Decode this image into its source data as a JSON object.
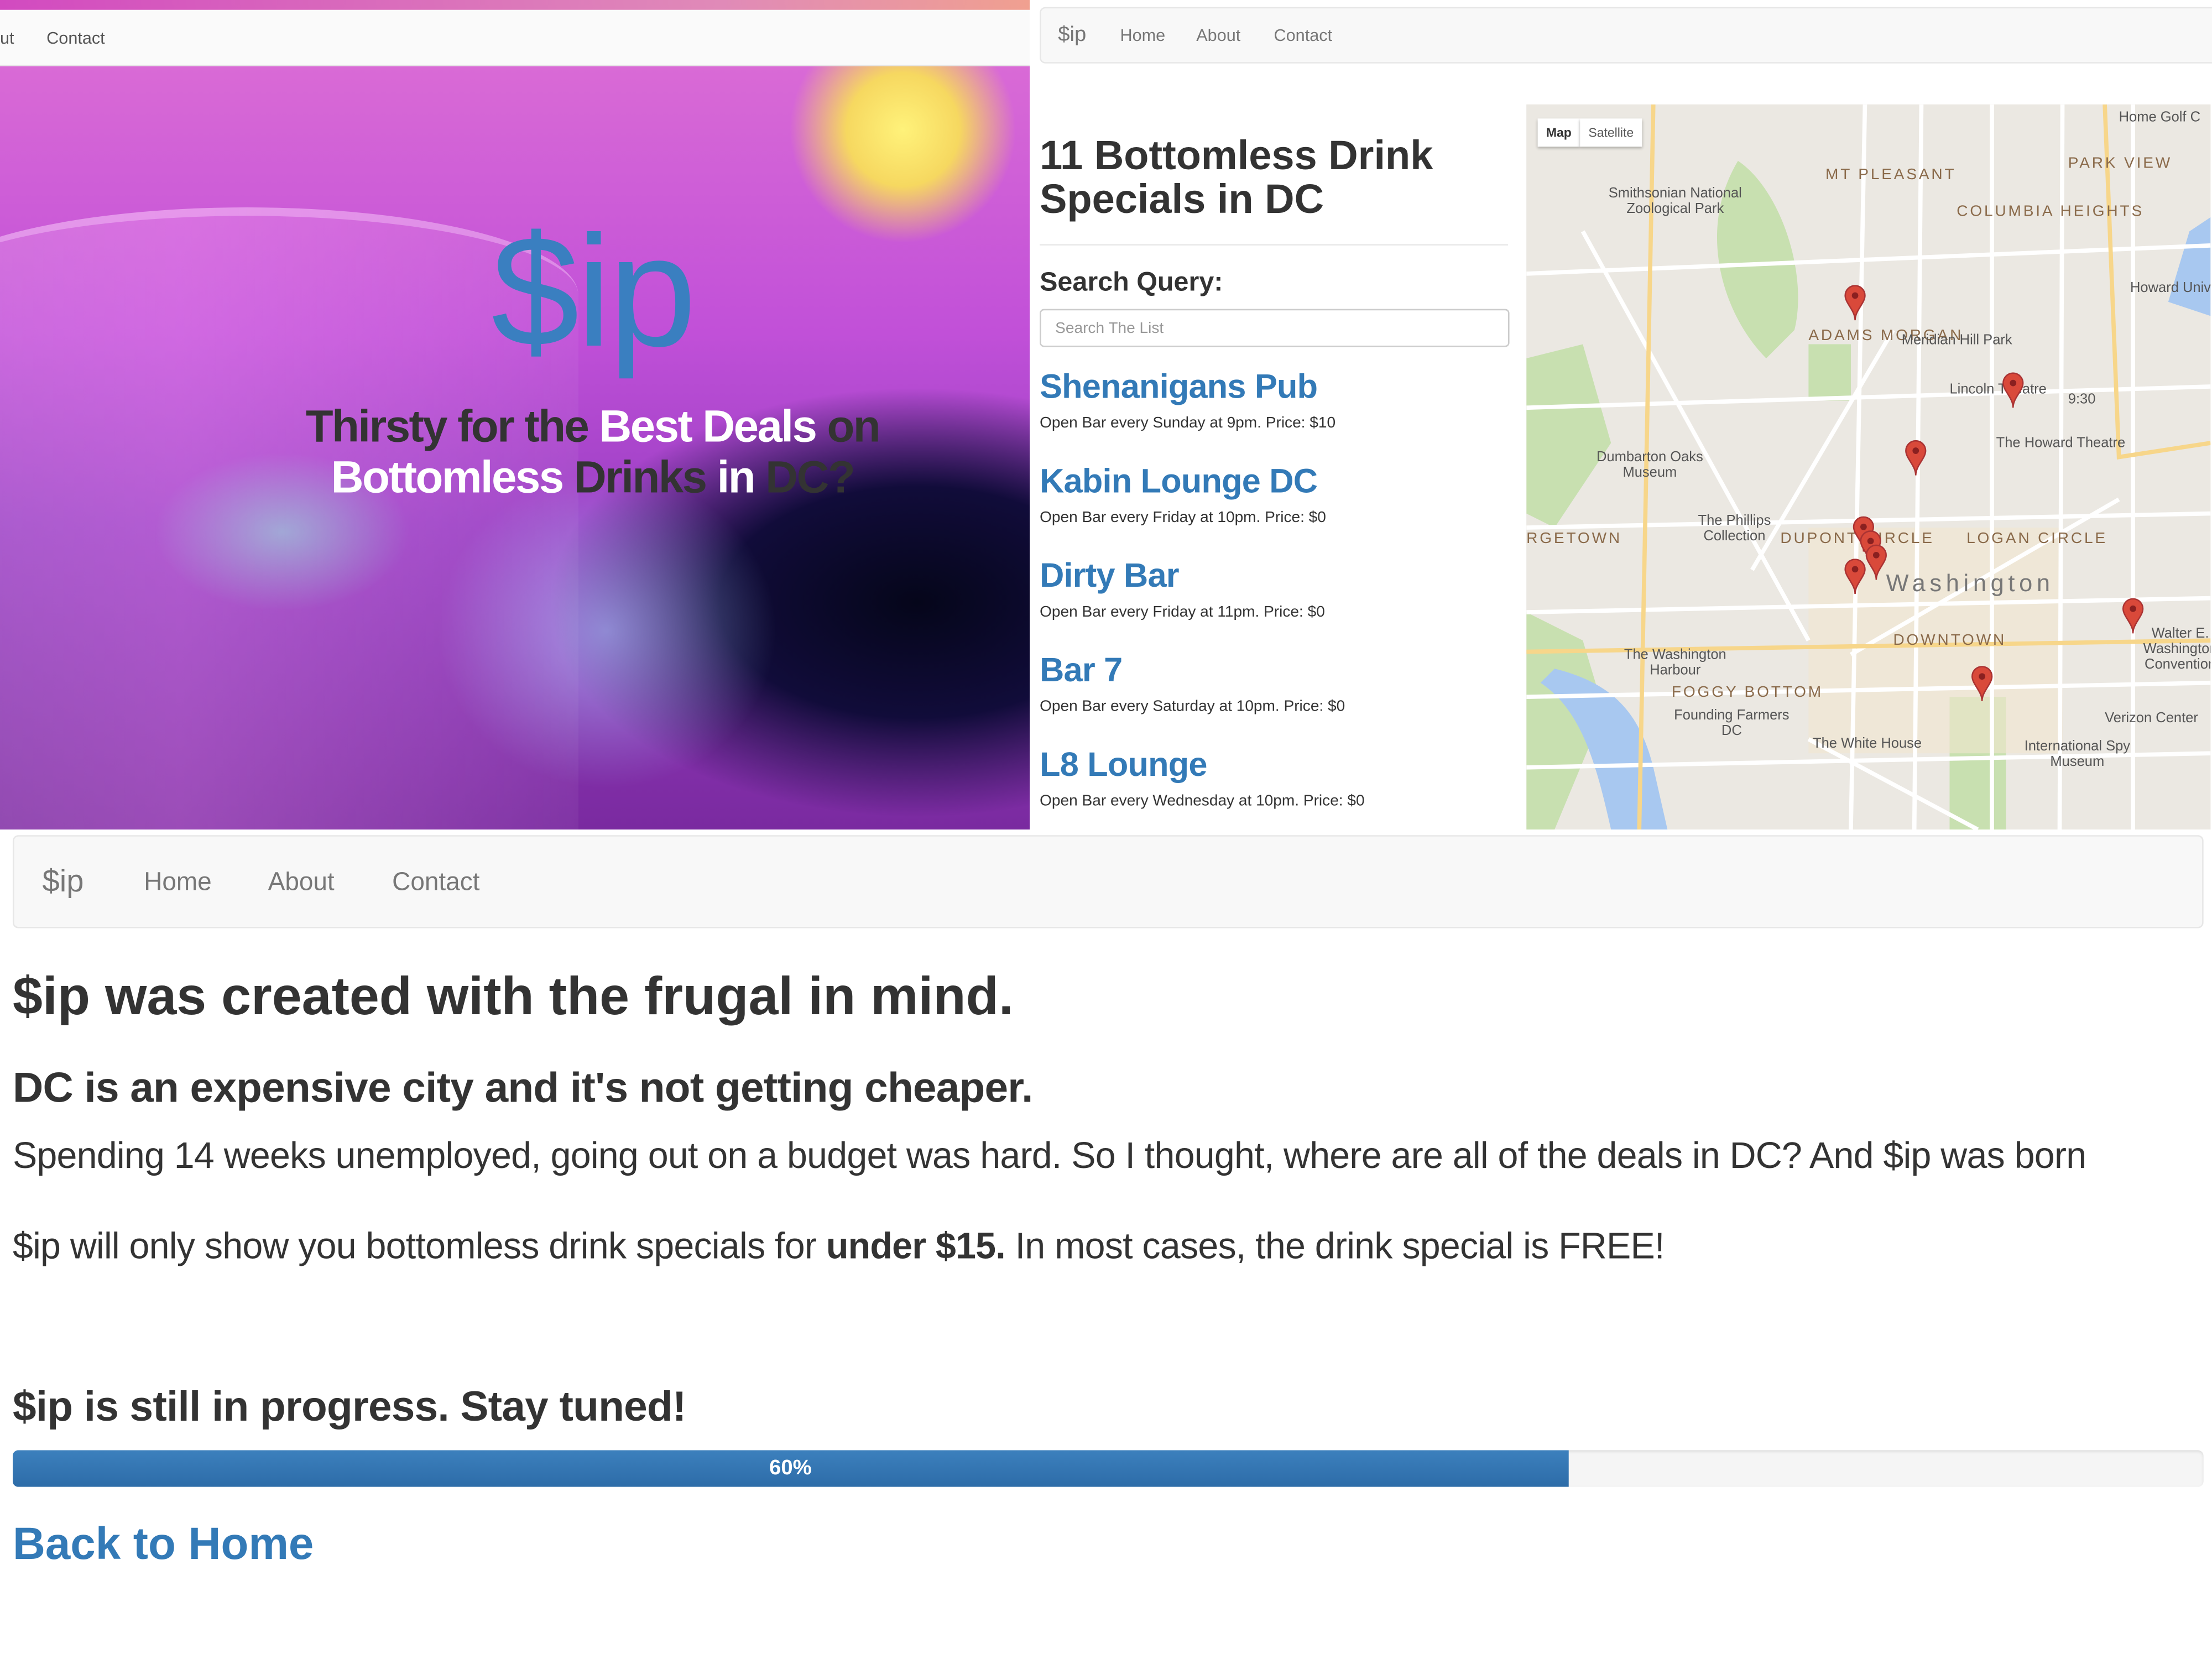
{
  "panel_home": {
    "nav": [
      "ut",
      "Contact"
    ],
    "logo": "$ip",
    "tagline": {
      "line1": [
        [
          "Thirsty for the ",
          "dark"
        ],
        [
          "Best Deals",
          "white"
        ],
        [
          " on",
          "dark"
        ]
      ],
      "line2": [
        [
          "Bottomless",
          "white"
        ],
        [
          " Drinks",
          "dark"
        ],
        [
          " in ",
          "white"
        ],
        [
          "DC?",
          "dark"
        ]
      ]
    }
  },
  "panel_list": {
    "nav": {
      "brand": "$ip",
      "home": "Home",
      "about": "About",
      "contact": "Contact"
    },
    "title_line1": "11 Bottomless Drink",
    "title_line2": "Specials in DC",
    "search_label": "Search Query:",
    "search_placeholder": "Search The List",
    "search_value": "",
    "items": [
      {
        "name": "Shenanigans Pub",
        "desc": "Open Bar every Sunday at 9pm. Price: $10"
      },
      {
        "name": "Kabin Lounge DC",
        "desc": "Open Bar every Friday at 10pm. Price: $0"
      },
      {
        "name": "Dirty Bar",
        "desc": "Open Bar every Friday at 11pm. Price: $0"
      },
      {
        "name": "Bar 7",
        "desc": "Open Bar every Saturday at 10pm. Price: $0"
      },
      {
        "name": "L8 Lounge",
        "desc": "Open Bar every Wednesday at 10pm. Price: $0"
      }
    ],
    "map": {
      "buttons": {
        "map": "Map",
        "satellite": "Satellite"
      },
      "labels": [
        "Smithsonian National Zoological Park",
        "MT PLEASANT",
        "COLUMBIA HEIGHTS",
        "PARK VIEW",
        "Howard University",
        "ADAMS MORGAN",
        "Meridian Hill Park",
        "Lincoln Theatre",
        "9:30",
        "The Howard Theatre",
        "Dumbarton Oaks Museum",
        "The Phillips Collection",
        "DUPONT CIRCLE",
        "LOGAN CIRCLE",
        "Washington",
        "DOWNTOWN",
        "RGETOWN",
        "The Washington Harbour",
        "FOGGY BOTTOM",
        "Founding Farmers DC",
        "The White House",
        "Verizon Center",
        "International Spy Museum",
        "Walter E. Washington Convention",
        "Home Golf C"
      ],
      "pin_color": "#d9493a"
    }
  },
  "panel_about": {
    "nav": {
      "brand": "$ip",
      "home": "Home",
      "about": "About",
      "contact": "Contact"
    },
    "heading": "$ip was created with the frugal in mind.",
    "subheading": "DC is an expensive city and it's not getting cheaper.",
    "para1": "Spending 14 weeks unemployed, going out on a budget was hard. So I thought, where are all of the deals in DC? And $ip was born",
    "para2_a": "$ip will only show you bottomless drink specials for ",
    "para2_b": "under $15.",
    "para2_c": " In most cases, the drink special is FREE!",
    "progress_heading": "$ip is still in progress. Stay tuned!",
    "progress_label": "60%",
    "progress_fill_percent": 71,
    "back_link": "Back to Home"
  },
  "colors": {
    "accent": "#337ab7",
    "logo": "#3a7fc0",
    "progress": "#337ab7"
  }
}
